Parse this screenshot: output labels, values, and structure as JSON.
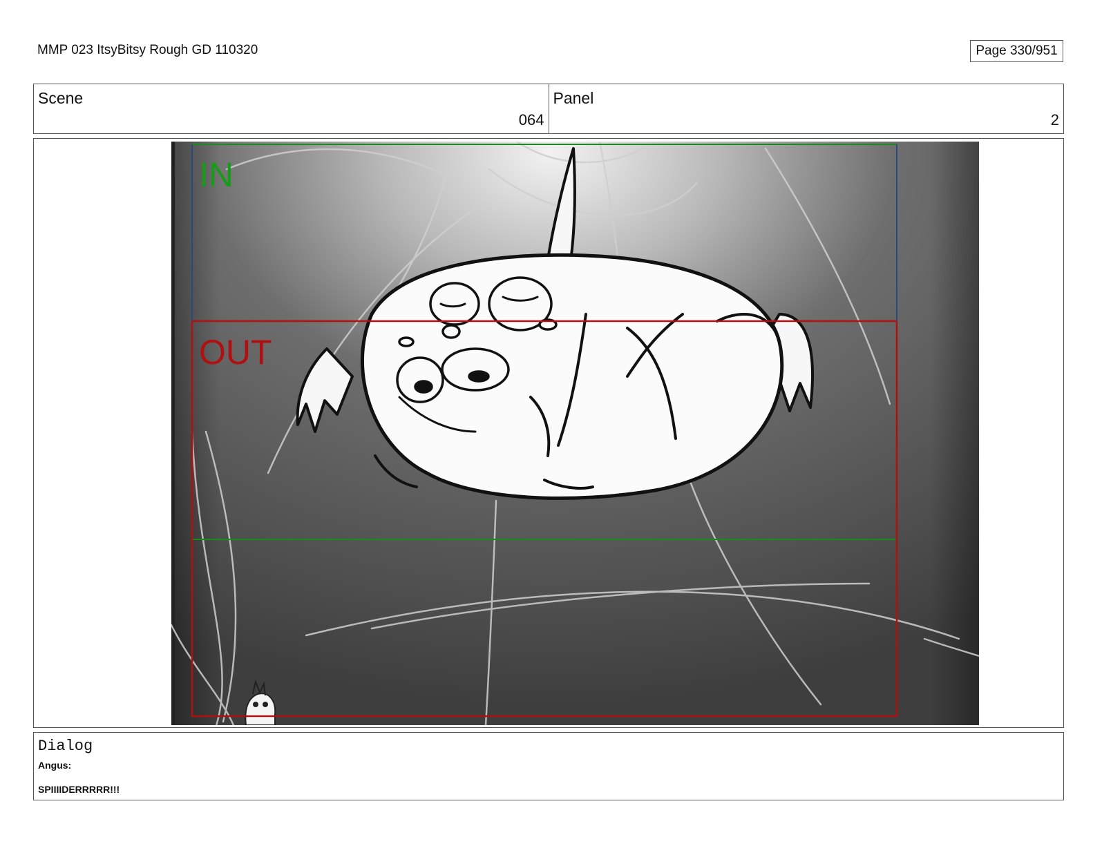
{
  "header": {
    "document_title": "MMP 023 ItsyBitsy Rough GD 110320",
    "page_indicator": "Page 330/951"
  },
  "info": {
    "scene_label": "Scene",
    "scene_value": "064",
    "panel_label": "Panel",
    "panel_value": "2"
  },
  "frame": {
    "in_marker": "IN",
    "out_marker": "OUT",
    "colors": {
      "in_frame": "#1a8a1a",
      "out_frame": "#b01010",
      "background_dark": "#3a3a3a",
      "background_light": "#f2f2f2"
    }
  },
  "dialog": {
    "heading": "Dialog",
    "speaker": "Angus:",
    "line": "SPIIIIDERRRRR!!!"
  }
}
